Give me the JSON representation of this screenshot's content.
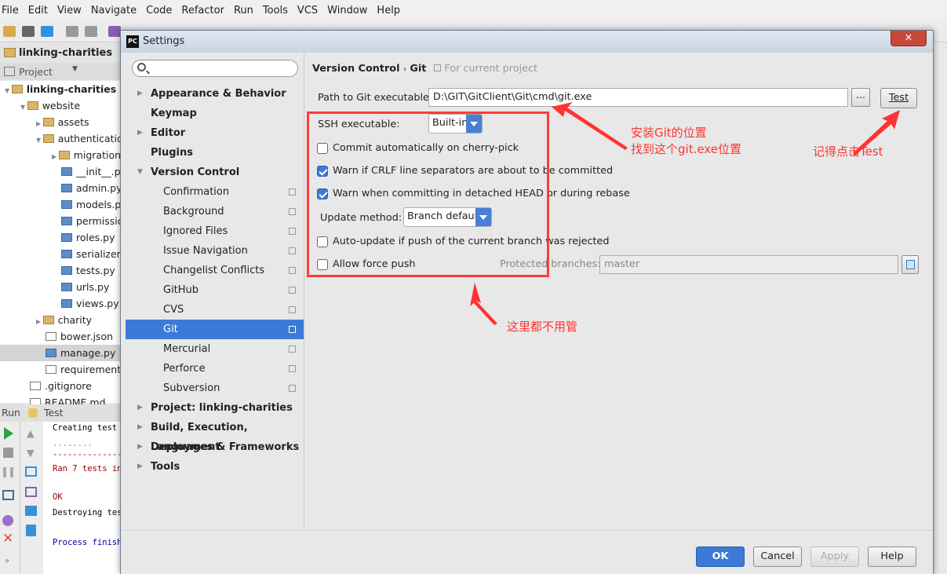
{
  "menubar": [
    "File",
    "Edit",
    "View",
    "Navigate",
    "Code",
    "Refactor",
    "Run",
    "Tools",
    "VCS",
    "Window",
    "Help"
  ],
  "nav": {
    "project": "linking-charities"
  },
  "project_panel": {
    "header": "Project",
    "tree": [
      {
        "label": "linking-charities",
        "depth": 0,
        "icon": "folder",
        "bold": true
      },
      {
        "label": "website",
        "depth": 1,
        "icon": "folder"
      },
      {
        "label": "assets",
        "depth": 2,
        "icon": "folder"
      },
      {
        "label": "authentication",
        "depth": 2,
        "icon": "folder"
      },
      {
        "label": "migrations",
        "depth": 3,
        "icon": "folder"
      },
      {
        "label": "__init__.py",
        "depth": 3,
        "icon": "python-file"
      },
      {
        "label": "admin.py",
        "depth": 3,
        "icon": "python-file"
      },
      {
        "label": "models.py",
        "depth": 3,
        "icon": "python-file"
      },
      {
        "label": "permissions.py",
        "depth": 3,
        "icon": "python-file"
      },
      {
        "label": "roles.py",
        "depth": 3,
        "icon": "python-file"
      },
      {
        "label": "serializers.py",
        "depth": 3,
        "icon": "python-file"
      },
      {
        "label": "tests.py",
        "depth": 3,
        "icon": "python-file"
      },
      {
        "label": "urls.py",
        "depth": 3,
        "icon": "python-file"
      },
      {
        "label": "views.py",
        "depth": 3,
        "icon": "python-file"
      },
      {
        "label": "charity",
        "depth": 2,
        "icon": "folder"
      },
      {
        "label": "bower.json",
        "depth": 2,
        "icon": "json-file"
      },
      {
        "label": "manage.py",
        "depth": 2,
        "icon": "python-file"
      },
      {
        "label": "requirements.txt",
        "depth": 2,
        "icon": "text-file"
      },
      {
        "label": ".gitignore",
        "depth": 1,
        "icon": "text-file"
      },
      {
        "label": "README.md",
        "depth": 1,
        "icon": "text-file"
      }
    ]
  },
  "run_panel": {
    "label": "Run",
    "config": "Test",
    "console": [
      {
        "text": "Creating test",
        "color": "#000000"
      },
      {
        "text": "........",
        "color": "#888888"
      },
      {
        "text": "--------------",
        "color": "#a00000"
      },
      {
        "text": "Ran 7 tests in",
        "color": "#a00000"
      },
      {
        "text": "OK",
        "color": "#a00000"
      },
      {
        "text": "Destroying tes",
        "color": "#000000"
      },
      {
        "text": "Process finish",
        "color": "#000099"
      }
    ]
  },
  "dialog": {
    "title": "Settings",
    "search_placeholder": "",
    "sidebar": [
      {
        "label": "Appearance & Behavior",
        "type": "top",
        "expandable": true
      },
      {
        "label": "Keymap",
        "type": "top"
      },
      {
        "label": "Editor",
        "type": "top",
        "expandable": true
      },
      {
        "label": "Plugins",
        "type": "top"
      },
      {
        "label": "Version Control",
        "type": "top",
        "expanded": true
      },
      {
        "label": "Confirmation",
        "type": "sub"
      },
      {
        "label": "Background",
        "type": "sub"
      },
      {
        "label": "Ignored Files",
        "type": "sub"
      },
      {
        "label": "Issue Navigation",
        "type": "sub"
      },
      {
        "label": "Changelist Conflicts",
        "type": "sub"
      },
      {
        "label": "GitHub",
        "type": "sub"
      },
      {
        "label": "CVS",
        "type": "sub"
      },
      {
        "label": "Git",
        "type": "sub",
        "selected": true
      },
      {
        "label": "Mercurial",
        "type": "sub"
      },
      {
        "label": "Perforce",
        "type": "sub"
      },
      {
        "label": "Subversion",
        "type": "sub"
      },
      {
        "label": "Project: linking-charities",
        "type": "top",
        "expandable": true
      },
      {
        "label": "Build, Execution, Deployment",
        "type": "top",
        "expandable": true
      },
      {
        "label": "Languages & Frameworks",
        "type": "top",
        "expandable": true
      },
      {
        "label": "Tools",
        "type": "top",
        "expandable": true
      }
    ],
    "breadcrumb": {
      "parent": "Version Control",
      "sep": "›",
      "current": "Git",
      "scope": "For current project"
    },
    "git": {
      "path_label": "Path to Git executable:",
      "path_value": "D:\\GIT\\GitClient\\Git\\cmd\\git.exe",
      "browse_label": "...",
      "test_label": "Test",
      "ssh_label": "SSH executable:",
      "ssh_value": "Built-in",
      "cherry_pick": {
        "label": "Commit automatically on cherry-pick",
        "checked": false
      },
      "crlf": {
        "label": "Warn if CRLF line separators are about to be committed",
        "checked": true
      },
      "detached": {
        "label": "Warn when committing in detached HEAD or during rebase",
        "checked": true
      },
      "update_label": "Update method:",
      "update_value": "Branch default",
      "auto_update": {
        "label": "Auto-update if push of the current branch was rejected",
        "checked": false
      },
      "force_push": {
        "label": "Allow force push",
        "checked": false
      },
      "protected_label": "Protected branches:",
      "protected_value": "master"
    },
    "buttons": {
      "ok": "OK",
      "cancel": "Cancel",
      "apply": "Apply",
      "help": "Help"
    }
  },
  "annotations": {
    "git_location_1": "安装Git的位置",
    "git_location_2": "找到这个git.exe位置",
    "click_test": "记得点击Test",
    "ignore": "这里都不用管",
    "color": "#ff3333"
  }
}
